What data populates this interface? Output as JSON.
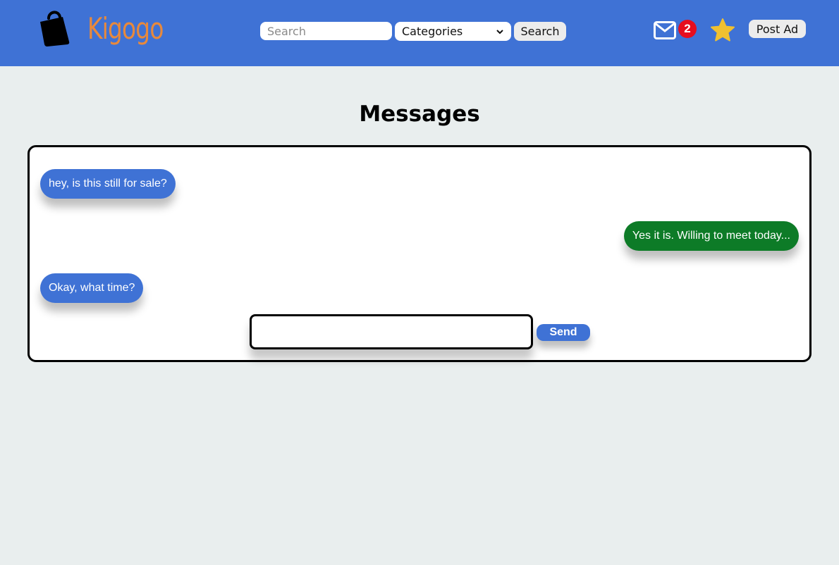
{
  "header": {
    "brand": "Kigogo",
    "logo_icon": "shopping-bag-icon",
    "search": {
      "placeholder": "Search",
      "value": ""
    },
    "category_select": {
      "selected": "Categories"
    },
    "search_button": "Search",
    "messages_icon": "envelope-icon",
    "unread_count": "2",
    "favorites_icon": "star-icon",
    "post_ad_button": "Post Ad"
  },
  "page": {
    "title": "Messages"
  },
  "conversation": {
    "messages": [
      {
        "text": "hey, is this still for sale?",
        "direction": "incoming"
      },
      {
        "text": "Yes it is. Willing to meet today...",
        "direction": "outgoing"
      },
      {
        "text": "Okay, what time?",
        "direction": "incoming"
      }
    ],
    "composer": {
      "value": "",
      "send_button": "Send"
    }
  },
  "colors": {
    "header_bg": "#3f72d5",
    "brand": "#e8893c",
    "incoming_bubble": "#3f72d5",
    "outgoing_bubble": "#0d7b27",
    "badge": "#e60d1e",
    "star": "#f0c030",
    "page_bg": "#e9eeee"
  }
}
